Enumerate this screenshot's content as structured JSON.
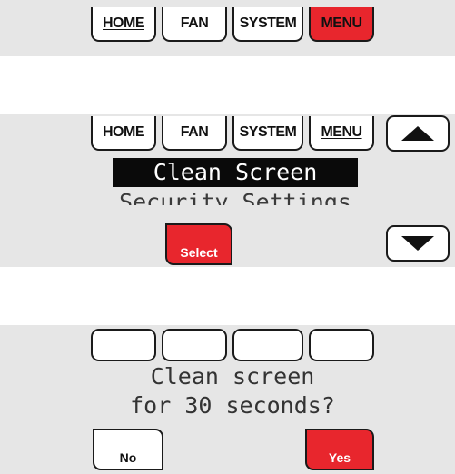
{
  "screen1": {
    "tabs": [
      {
        "label": "HOME",
        "underlined": true
      },
      {
        "label": "FAN",
        "underlined": false
      },
      {
        "label": "SYSTEM",
        "underlined": false
      },
      {
        "label": "MENU",
        "underlined": false,
        "active": true
      }
    ]
  },
  "screen2": {
    "tabs": [
      {
        "label": "HOME",
        "underlined": false
      },
      {
        "label": "FAN",
        "underlined": false
      },
      {
        "label": "SYSTEM",
        "underlined": false
      },
      {
        "label": "MENU",
        "underlined": true
      }
    ],
    "menu_selected": "Clean Screen",
    "menu_next": "Security Settings",
    "select_label": "Select",
    "up_icon": "triangle-up-icon",
    "down_icon": "triangle-down-icon"
  },
  "screen3": {
    "prompt_line1": "Clean screen",
    "prompt_line2": "for 30 seconds?",
    "no_label": "No",
    "yes_label": "Yes"
  },
  "colors": {
    "panel_bg": "#e6e6e6",
    "accent_red": "#e8262d",
    "lcd_text": "#333333"
  }
}
